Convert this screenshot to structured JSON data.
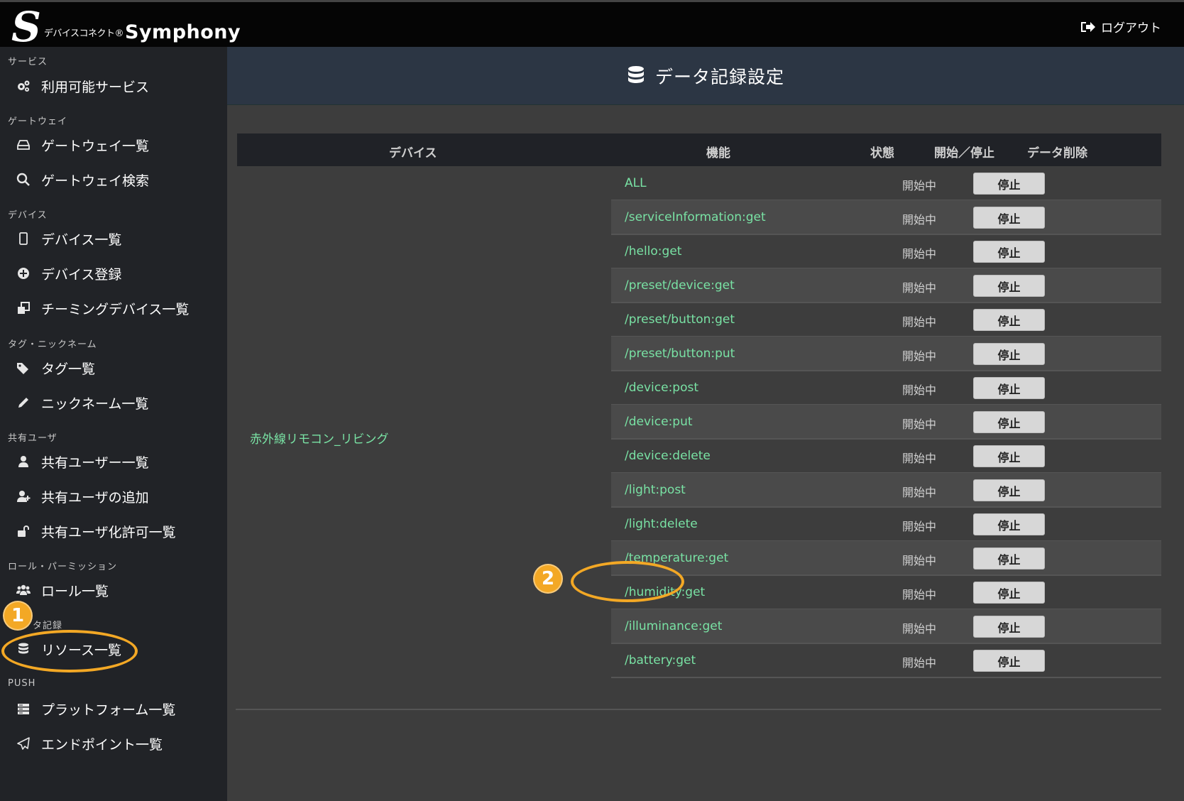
{
  "app": {
    "logo_mark": "S",
    "logo_sub": "デバイスコネクト®",
    "logo_main": "Symphony",
    "logout_label": "ログアウト"
  },
  "sidebar": {
    "sections": [
      {
        "label": "サービス",
        "items": [
          {
            "label": "利用可能サービス",
            "icon": "gears-icon"
          }
        ]
      },
      {
        "label": "ゲートウェイ",
        "items": [
          {
            "label": "ゲートウェイ一覧",
            "icon": "hdd-icon"
          },
          {
            "label": "ゲートウェイ検索",
            "icon": "search-icon"
          }
        ]
      },
      {
        "label": "デバイス",
        "items": [
          {
            "label": "デバイス一覧",
            "icon": "tablet-icon"
          },
          {
            "label": "デバイス登録",
            "icon": "plus-circle-icon"
          },
          {
            "label": "チーミングデバイス一覧",
            "icon": "clone-icon"
          }
        ]
      },
      {
        "label": "タグ・ニックネーム",
        "items": [
          {
            "label": "タグ一覧",
            "icon": "tags-icon"
          },
          {
            "label": "ニックネーム一覧",
            "icon": "pencil-icon"
          }
        ]
      },
      {
        "label": "共有ユーザ",
        "items": [
          {
            "label": "共有ユーザー一覧",
            "icon": "user-icon"
          },
          {
            "label": "共有ユーザの追加",
            "icon": "user-plus-icon"
          },
          {
            "label": "共有ユーザ化許可一覧",
            "icon": "unlock-icon"
          }
        ]
      },
      {
        "label": "ロール・パーミッション",
        "items": [
          {
            "label": "ロール一覧",
            "icon": "users-icon"
          }
        ]
      },
      {
        "label": "タ記録",
        "items": [
          {
            "label": "リソース一覧",
            "icon": "database-icon"
          }
        ]
      },
      {
        "label": "PUSH",
        "items": [
          {
            "label": "プラットフォーム一覧",
            "icon": "server-icon"
          },
          {
            "label": "エンドポイント一覧",
            "icon": "paper-plane-icon"
          }
        ]
      }
    ]
  },
  "page": {
    "title": "データ記録設定",
    "title_icon": "database-icon"
  },
  "table": {
    "headers": {
      "device": "デバイス",
      "function": "機能",
      "status": "状態",
      "start_stop": "開始／停止",
      "delete": "データ削除"
    },
    "device_name": "赤外線リモコン_リビング",
    "rows": [
      {
        "function": "ALL",
        "status": "開始中",
        "action": "停止"
      },
      {
        "function": "/serviceInformation:get",
        "status": "開始中",
        "action": "停止"
      },
      {
        "function": "/hello:get",
        "status": "開始中",
        "action": "停止"
      },
      {
        "function": "/preset/device:get",
        "status": "開始中",
        "action": "停止"
      },
      {
        "function": "/preset/button:get",
        "status": "開始中",
        "action": "停止"
      },
      {
        "function": "/preset/button:put",
        "status": "開始中",
        "action": "停止"
      },
      {
        "function": "/device:post",
        "status": "開始中",
        "action": "停止"
      },
      {
        "function": "/device:put",
        "status": "開始中",
        "action": "停止"
      },
      {
        "function": "/device:delete",
        "status": "開始中",
        "action": "停止"
      },
      {
        "function": "/light:post",
        "status": "開始中",
        "action": "停止"
      },
      {
        "function": "/light:delete",
        "status": "開始中",
        "action": "停止"
      },
      {
        "function": "/temperature:get",
        "status": "開始中",
        "action": "停止"
      },
      {
        "function": "/humidity:get",
        "status": "開始中",
        "action": "停止"
      },
      {
        "function": "/illuminance:get",
        "status": "開始中",
        "action": "停止"
      },
      {
        "function": "/battery:get",
        "status": "開始中",
        "action": "停止"
      }
    ]
  },
  "annotations": {
    "badge1": "1",
    "badge2": "2",
    "color": "#f3a825"
  }
}
